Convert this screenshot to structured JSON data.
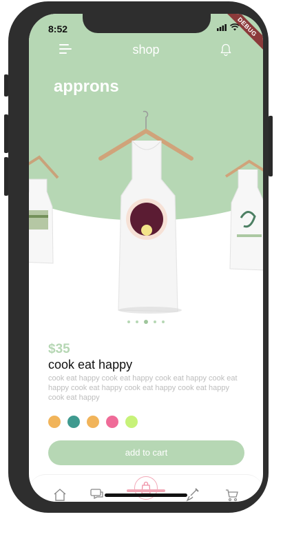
{
  "status": {
    "time": "8:52",
    "debug_label": "DEBUG"
  },
  "topbar": {
    "title": "shop",
    "menu_icon": "menu-icon",
    "bell_icon": "bell-icon"
  },
  "category": "approns",
  "carousel": {
    "page_count": 5,
    "active_index": 2
  },
  "product": {
    "price": "$35",
    "name": "cook eat happy",
    "description": "cook eat happy cook eat happy cook eat happy cook eat happy cook eat happy cook eat happy cook eat happy cook eat happy"
  },
  "colors": [
    "#f1b45a",
    "#3f9a8f",
    "#f1b45a",
    "#ef6b98",
    "#c7f279"
  ],
  "actions": {
    "add_to_cart": "add to cart"
  },
  "nav": [
    "home-icon",
    "chat-icon",
    "shopping-bag-icon",
    "brush-icon",
    "cart-icon"
  ],
  "theme": {
    "accent": "#b6d7b4",
    "nav_active": "#f2a7b6"
  }
}
